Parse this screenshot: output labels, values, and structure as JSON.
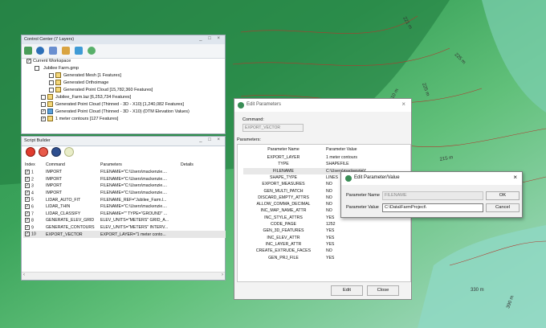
{
  "map": {
    "contour_labels": [
      "221 m",
      "225 m",
      "225 m",
      "310 m",
      "215 m",
      "330 m",
      "390 m"
    ]
  },
  "control_center": {
    "title": "Control Center (7 Layers)",
    "window_controls": "_ □ ×",
    "tree": [
      {
        "label": "Current Workspace"
      },
      {
        "label": "Jubilee Farm.gmp"
      },
      {
        "label": "Generated Mesh [1 Features]"
      },
      {
        "label": "Generated Orthoimage"
      },
      {
        "label": "Generated Point Cloud [15,782,360 Features]"
      },
      {
        "label": "Jubilee_Farm.laz [6,253,734 Features]"
      },
      {
        "label": "Generated Point Cloud (Thinned - 3D - X10) [1,240,082 Features]"
      },
      {
        "label": "Generated Point Cloud (Thinned - 3D - X10) (DTM Elevation Values)"
      },
      {
        "label": "1 meter contours [127 Features]"
      }
    ]
  },
  "script_builder": {
    "title": "Script Builder",
    "window_controls": "_ □ ×",
    "headers": [
      "Index",
      "Command",
      "Parameters",
      "Details"
    ],
    "rows": [
      {
        "index": "1",
        "command": "IMPORT",
        "params": "FILENAME=\"C:\\Users\\mackenzie...."
      },
      {
        "index": "2",
        "command": "IMPORT",
        "params": "FILENAME=\"C:\\Users\\mackenzie...."
      },
      {
        "index": "3",
        "command": "IMPORT",
        "params": "FILENAME=\"C:\\Users\\mackenzie...."
      },
      {
        "index": "4",
        "command": "IMPORT",
        "params": "FILENAME=\"C:\\Users\\mackenzie...."
      },
      {
        "index": "5",
        "command": "LIDAR_AUTO_FIT",
        "params": "FILENAME_REF=\"Jubilee_Farm.l..."
      },
      {
        "index": "6",
        "command": "LIDAR_THIN",
        "params": "FILENAME=\"C:\\Users\\mackenzie...."
      },
      {
        "index": "7",
        "command": "LIDAR_CLASSIFY",
        "params": "FILENAME=\"\" TYPE=\"GROUND\" ..."
      },
      {
        "index": "8",
        "command": "GENERATE_ELEV_GRID",
        "params": "ELEV_UNITS=\"METERS\" GRID_A..."
      },
      {
        "index": "9",
        "command": "GENERATE_CONTOURS",
        "params": "ELEV_UNITS=\"METERS\" INTERV..."
      },
      {
        "index": "10",
        "command": "EXPORT_VECTOR",
        "params": "EXPORT_LAYER=\"1 meter conto..."
      }
    ]
  },
  "edit_parameters": {
    "title": "Edit Parameters",
    "close": "×",
    "command_label": "Command:",
    "command_value": "EXPORT_VECTOR",
    "parameters_label": "Parameters:",
    "headers": [
      "Parameter Name",
      "Parameter Value"
    ],
    "rows": [
      {
        "name": "EXPORT_LAYER",
        "value": "1 meter contours"
      },
      {
        "name": "TYPE",
        "value": "SHAPEFILE"
      },
      {
        "name": "FILENAME",
        "value": "C:\\Users\\mackenzie\\Desktop\\"
      },
      {
        "name": "SHAPE_TYPE",
        "value": "LINES"
      },
      {
        "name": "EXPORT_MEASURES",
        "value": "NO"
      },
      {
        "name": "GEN_MULTI_PATCH",
        "value": "NO"
      },
      {
        "name": "DISCARD_EMPTY_ATTRS",
        "value": "NO"
      },
      {
        "name": "ALLOW_COMMA_DECIMAL",
        "value": "NO"
      },
      {
        "name": "INC_MAP_NAME_ATTR",
        "value": "NO"
      },
      {
        "name": "INC_STYLE_ATTRS",
        "value": "YES"
      },
      {
        "name": "CODE_PAGE",
        "value": "1252"
      },
      {
        "name": "GEN_3D_FEATURES",
        "value": "YES"
      },
      {
        "name": "INC_ELEV_ATTR",
        "value": "YES"
      },
      {
        "name": "INC_LAYER_ATTR",
        "value": "YES"
      },
      {
        "name": "CREATE_EXTRUDE_FACES",
        "value": "NO"
      },
      {
        "name": "GEN_PRJ_FILE",
        "value": "YES"
      }
    ],
    "edit_button": "Edit",
    "close_button": "Close"
  },
  "edit_parameter_value": {
    "title": "Edit Parameter/Value",
    "close": "×",
    "name_label": "Parameter Name",
    "name_value": "FILENAME",
    "value_label": "Parameter Value",
    "value_value": "C:\\Data\\FarmProject\\",
    "ok_button": "OK",
    "cancel_button": "Cancel"
  }
}
